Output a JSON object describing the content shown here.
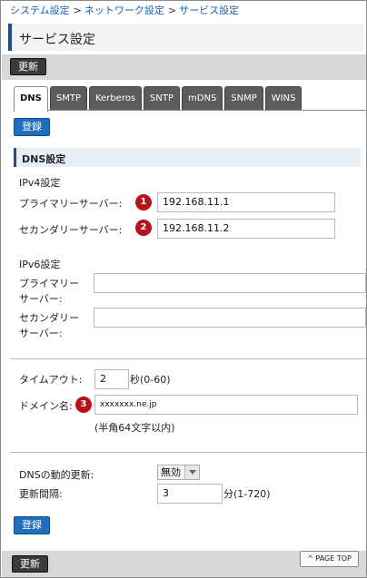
{
  "breadcrumb": {
    "items": [
      "システム設定",
      "ネットワーク設定",
      "サービス設定"
    ],
    "separator": ">"
  },
  "page_title": "サービス設定",
  "toolbar": {
    "update_label": "更新"
  },
  "tabs": [
    {
      "label": "DNS",
      "active": true
    },
    {
      "label": "SMTP",
      "active": false
    },
    {
      "label": "Kerberos",
      "active": false
    },
    {
      "label": "SNTP",
      "active": false
    },
    {
      "label": "mDNS",
      "active": false
    },
    {
      "label": "SNMP",
      "active": false
    },
    {
      "label": "WINS",
      "active": false
    }
  ],
  "register_label": "登録",
  "section_title": "DNS設定",
  "ipv4": {
    "heading": "IPv4設定",
    "primary_label": "プライマリーサーバー:",
    "primary_value": "192.168.11.1",
    "secondary_label": "セカンダリーサーバー:",
    "secondary_value": "192.168.11.2"
  },
  "ipv6": {
    "heading": "IPv6設定",
    "primary_label_line1": "プライマリー",
    "primary_label_line2": "サーバー:",
    "primary_value": "",
    "secondary_label_line1": "セカンダリー",
    "secondary_label_line2": "サーバー:",
    "secondary_value": ""
  },
  "timeout": {
    "label": "タイムアウト:",
    "value": "2",
    "unit": "秒(0-60)"
  },
  "domain": {
    "label": "ドメイン名:",
    "value": "xxxxxxx.ne.jp",
    "hint": "(半角64文字以内)"
  },
  "dynamic_update": {
    "label": "DNSの動的更新:",
    "selected": "無効",
    "interval_label": "更新間隔:",
    "interval_value": "3",
    "interval_unit": "分(1-720)"
  },
  "badges": [
    "1",
    "2",
    "3"
  ],
  "page_top_label": "PAGE TOP",
  "colors": {
    "accent_blue": "#1f6fbf",
    "link_blue": "#1a5fb4",
    "badge_red": "#b5121b",
    "tab_gray": "#5c5c5c",
    "band_gray": "#d8d8d8"
  }
}
